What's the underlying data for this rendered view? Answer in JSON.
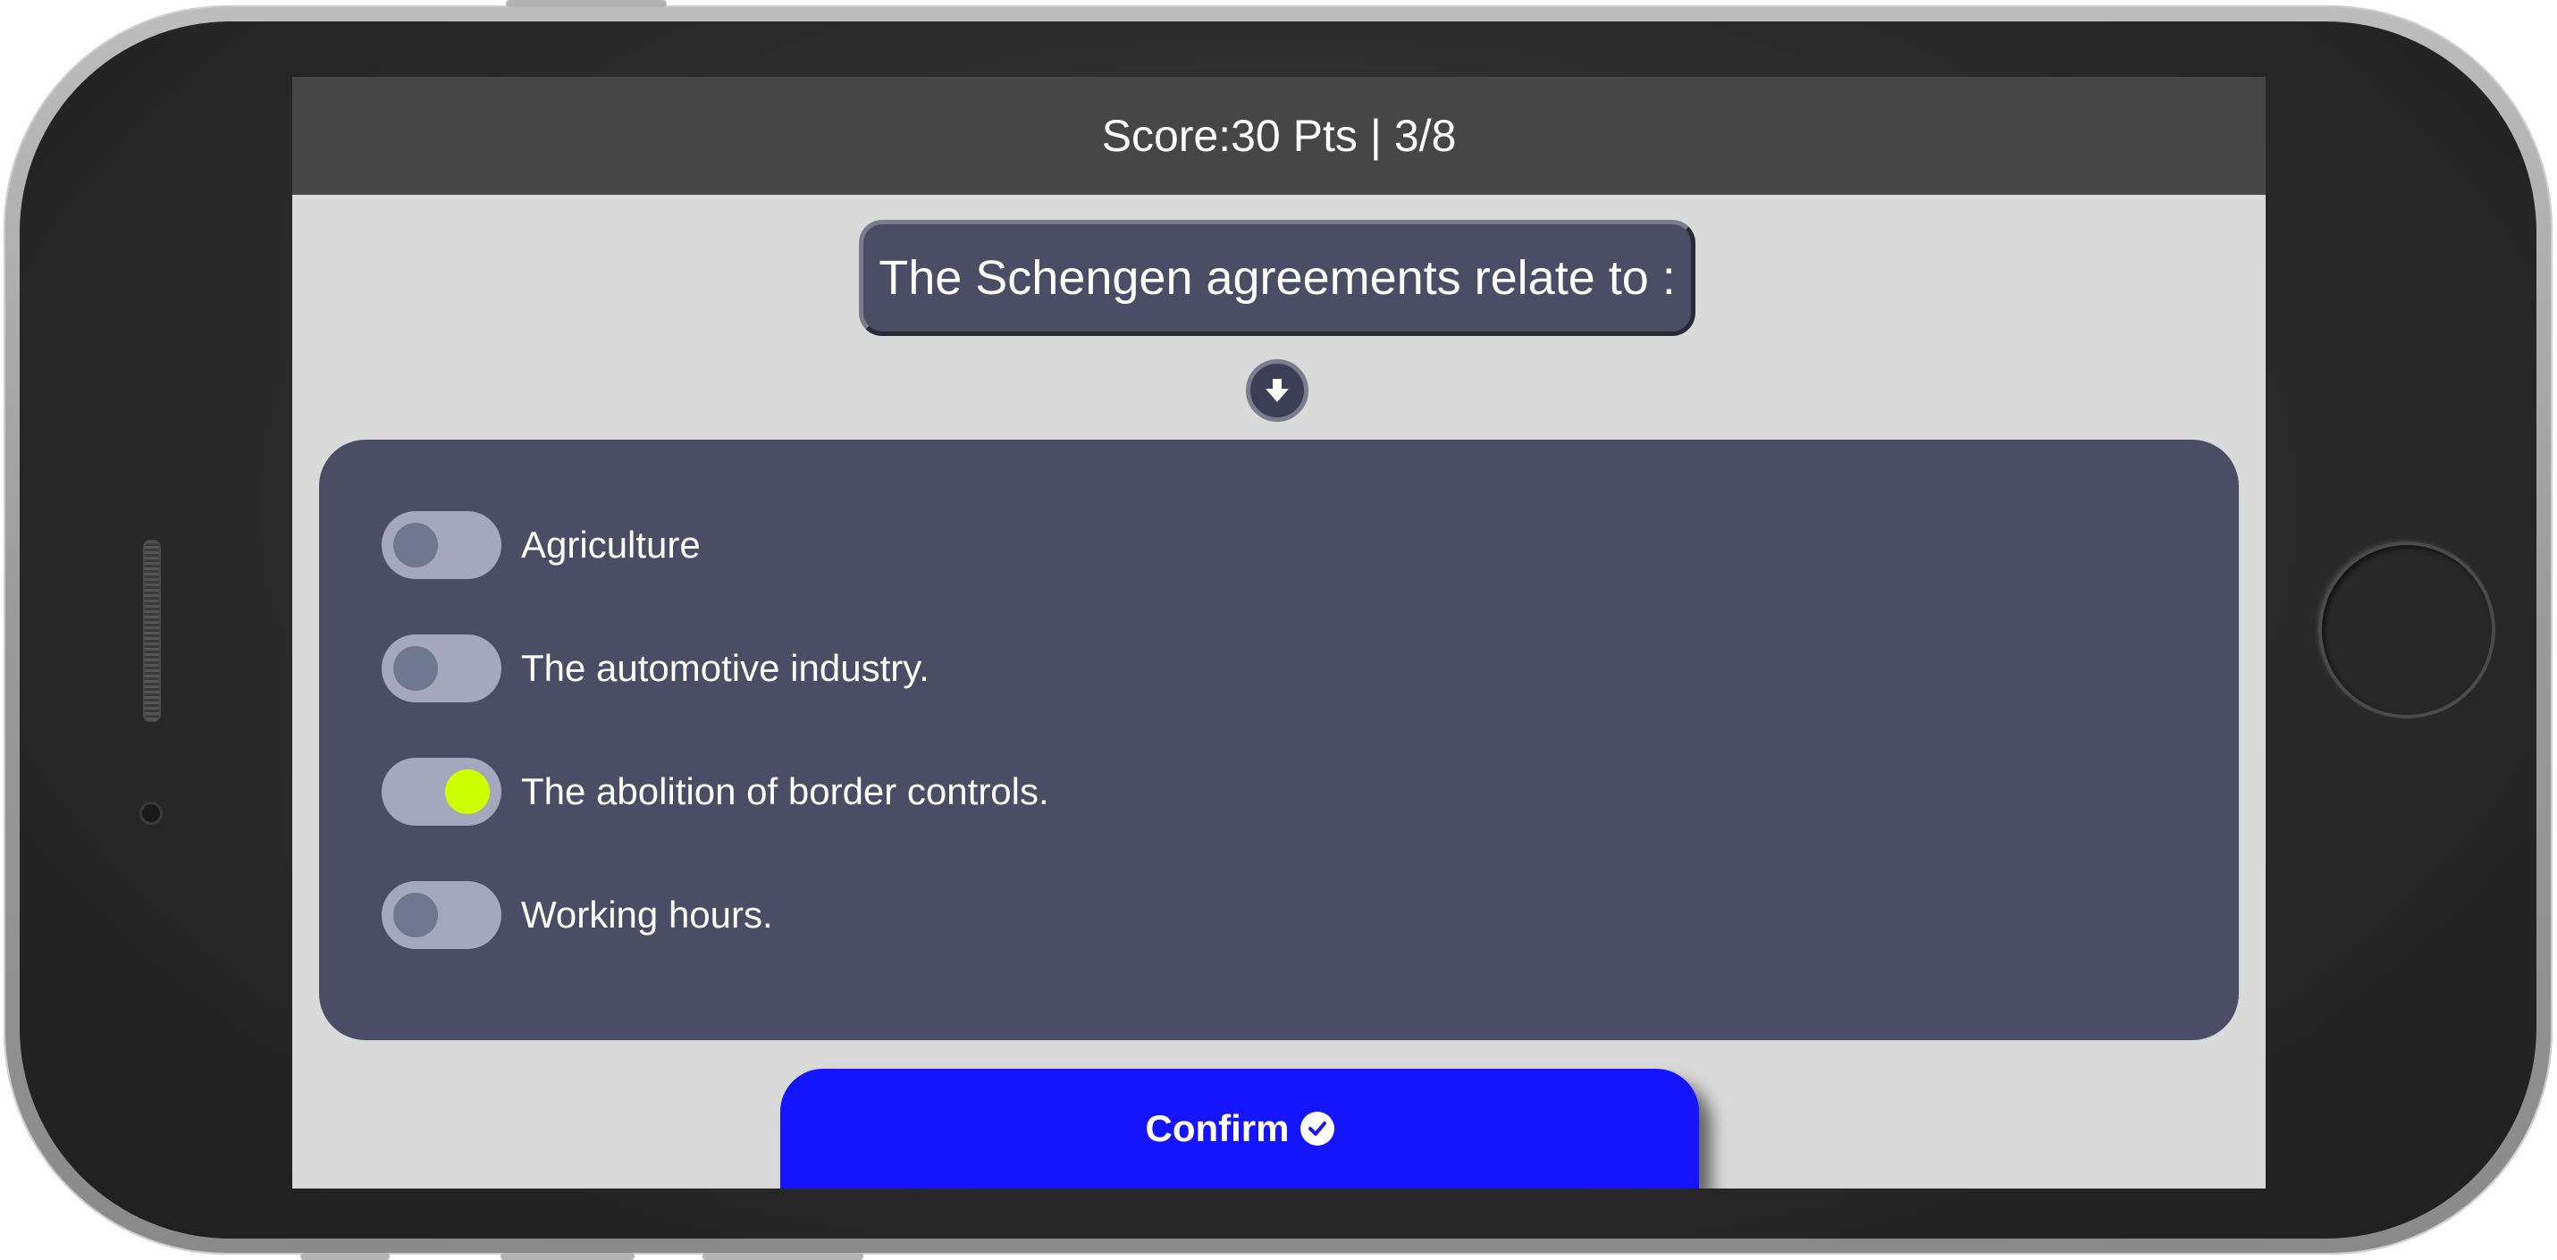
{
  "header": {
    "score_text": "Score:30 Pts",
    "separator": "|",
    "progress_text": "3/8"
  },
  "question": {
    "text": "The Schengen agreements relate to :"
  },
  "answers": [
    {
      "label": "Agriculture",
      "selected": false
    },
    {
      "label": "The automotive industry.",
      "selected": false
    },
    {
      "label": "The abolition of border controls.",
      "selected": true
    },
    {
      "label": "Working hours.",
      "selected": false
    }
  ],
  "confirm": {
    "label": "Confirm",
    "icon": "check-circle-icon"
  },
  "colors": {
    "header_bg": "#464646",
    "screen_bg": "#dadada",
    "panel_bg": "#4b4d65",
    "toggle_track": "#a5a7bd",
    "toggle_knob_off": "#6f7891",
    "toggle_knob_on": "#ccff00",
    "confirm_bg": "#1414ff"
  },
  "icons": {
    "scroll_down": "arrow-down-icon"
  }
}
